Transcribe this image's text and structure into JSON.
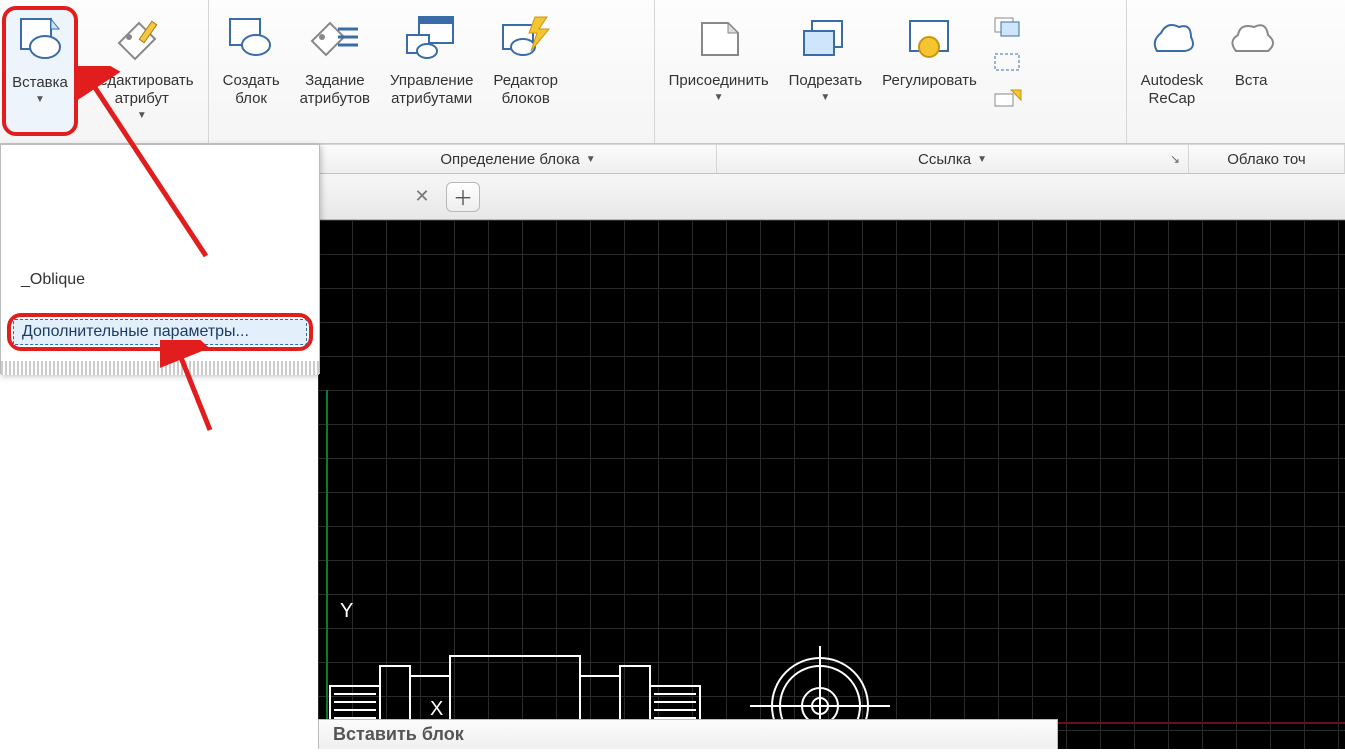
{
  "ribbon": {
    "insert": {
      "label": "Вставка"
    },
    "edit_attr": {
      "label1": "Редактировать",
      "label2": "атрибут"
    },
    "create_block": {
      "label1": "Создать",
      "label2": "блок"
    },
    "define_attr": {
      "label1": "Задание",
      "label2": "атрибутов"
    },
    "manage_attr": {
      "label1": "Управление",
      "label2": "атрибутами"
    },
    "block_editor": {
      "label1": "Редактор",
      "label2": "блоков"
    },
    "attach": {
      "label": "Присоединить"
    },
    "clip": {
      "label": "Подрезать"
    },
    "adjust": {
      "label": "Регулировать"
    },
    "recap": {
      "label1": "Autodesk",
      "label2": "ReCap"
    },
    "vsta": {
      "label": "Вста"
    }
  },
  "panels": {
    "block_def": "Определение блока",
    "reference": "Ссылка",
    "point_cloud": "Облако точ"
  },
  "dropdown": {
    "oblique": "_Oblique",
    "more_params": "Дополнительные параметры..."
  },
  "tooltip": {
    "title": "Вставить блок"
  },
  "axes": {
    "x": "X",
    "y": "Y"
  }
}
